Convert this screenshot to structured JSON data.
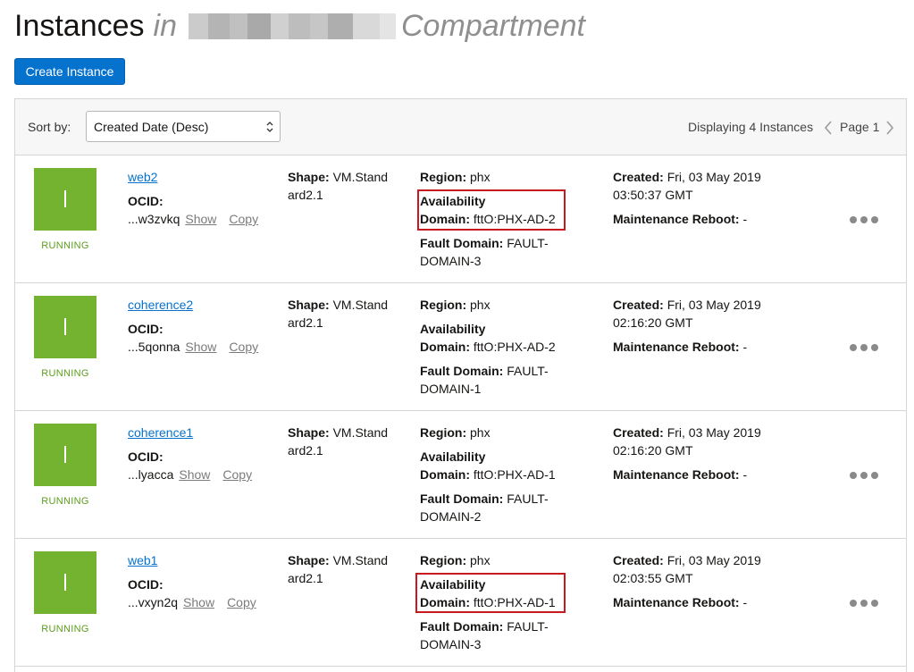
{
  "header": {
    "title": "Instances",
    "in_word": "in",
    "compartment_suffix": "Compartment"
  },
  "toolbar": {
    "create_button": "Create Instance",
    "sort_label": "Sort by:",
    "sort_value": "Created Date (Desc)",
    "display_text": "Displaying 4 Instances",
    "page_text": "Page 1"
  },
  "labels": {
    "ocid": "OCID:",
    "show": "Show",
    "copy": "Copy",
    "shape": "Shape:",
    "region": "Region:",
    "availability": "Availability",
    "domain": "Domain:",
    "fault_domain": "Fault Domain:",
    "created": "Created:",
    "maintenance": "Maintenance Reboot:"
  },
  "instances": [
    {
      "name": "web2",
      "status": "RUNNING",
      "ocid": "...w3zvkq",
      "shape_1": "VM.Stand",
      "shape_2": "ard2.1",
      "region": "phx",
      "ad": "fttO:PHX-AD-2",
      "fault_1": "FAULT-",
      "fault_2": "DOMAIN-3",
      "created_1": "Fri, 03 May 2019",
      "created_2": "03:50:37 GMT",
      "maintenance": "-"
    },
    {
      "name": "coherence2",
      "status": "RUNNING",
      "ocid": "...5qonna",
      "shape_1": "VM.Stand",
      "shape_2": "ard2.1",
      "region": "phx",
      "ad": "fttO:PHX-AD-2",
      "fault_1": "FAULT-",
      "fault_2": "DOMAIN-1",
      "created_1": "Fri, 03 May 2019",
      "created_2": "02:16:20 GMT",
      "maintenance": "-"
    },
    {
      "name": "coherence1",
      "status": "RUNNING",
      "ocid": "...lyacca",
      "shape_1": "VM.Stand",
      "shape_2": "ard2.1",
      "region": "phx",
      "ad": "fttO:PHX-AD-1",
      "fault_1": "FAULT-",
      "fault_2": "DOMAIN-2",
      "created_1": "Fri, 03 May 2019",
      "created_2": "02:16:20 GMT",
      "maintenance": "-"
    },
    {
      "name": "web1",
      "status": "RUNNING",
      "ocid": "...vxyn2q",
      "shape_1": "VM.Stand",
      "shape_2": "ard2.1",
      "region": "phx",
      "ad": "fttO:PHX-AD-1",
      "fault_1": "FAULT-",
      "fault_2": "DOMAIN-3",
      "created_1": "Fri, 03 May 2019",
      "created_2": "02:03:55 GMT",
      "maintenance": "-"
    }
  ],
  "colors": {
    "primary": "#0572ce",
    "running": "#74b330",
    "running_text": "#5c9e1e",
    "highlight": "#c8191f",
    "redacted_blocks": [
      "#cbcbcb",
      "#b4b4b4",
      "#c0c0c0",
      "#a9a9a9",
      "#d0d0d0",
      "#bdbdbd",
      "#c6c6c6",
      "#aeaeae",
      "#d9d9d9",
      "#e4e4e4"
    ]
  },
  "icons": {
    "sort_select": "up-down-chevron-icon",
    "prev_page": "chevron-left-icon",
    "next_page": "chevron-right-icon",
    "row_menu": "more-dots-icon",
    "instance": "instance-icon"
  }
}
